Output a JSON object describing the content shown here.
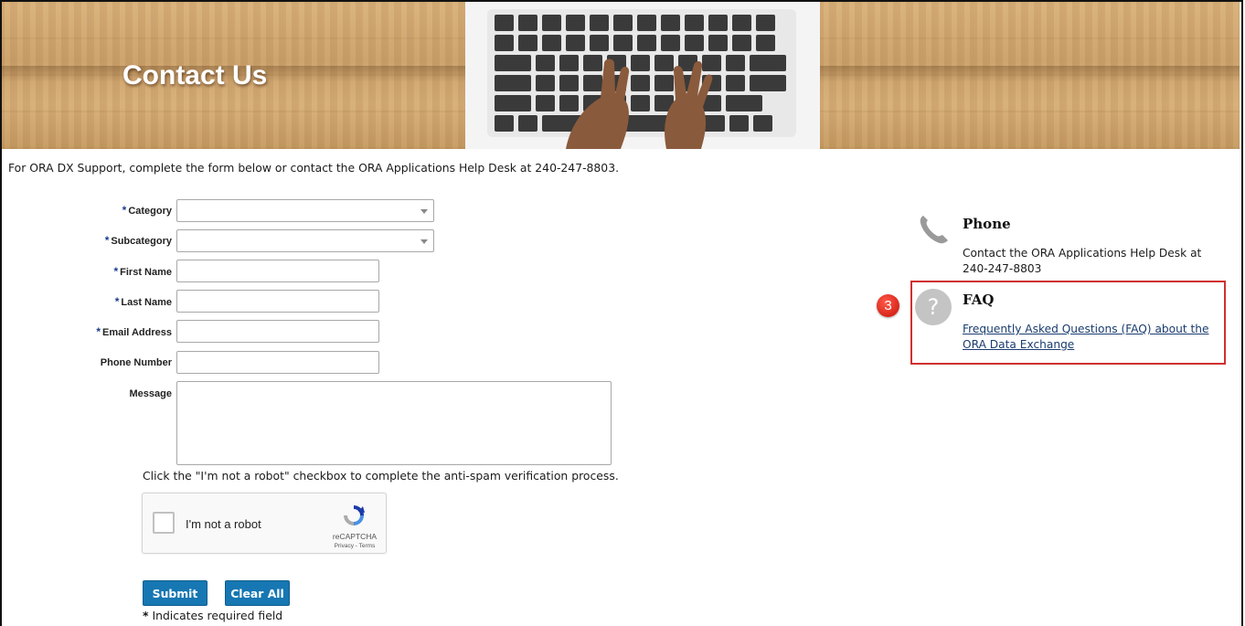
{
  "banner": {
    "title": "Contact Us"
  },
  "intro": "For ORA DX Support, complete the form below or contact the ORA Applications Help Desk at 240-247-8803.",
  "form": {
    "required_marker": "*",
    "category": {
      "label": "Category",
      "value": ""
    },
    "subcategory": {
      "label": "Subcategory",
      "value": ""
    },
    "first_name": {
      "label": "First Name",
      "value": ""
    },
    "last_name": {
      "label": "Last Name",
      "value": ""
    },
    "email": {
      "label": "Email Address",
      "value": ""
    },
    "phone": {
      "label": "Phone Number",
      "value": ""
    },
    "message": {
      "label": "Message",
      "value": ""
    },
    "captcha_note": "Click the \"I'm not a robot\" checkbox to complete the anti-spam verification process.",
    "captcha": {
      "label": "I'm not a robot",
      "brand": "reCAPTCHA",
      "terms": "Privacy - Terms",
      "checked": false
    },
    "submit_label": "Submit",
    "clear_label": "Clear All",
    "required_note_star": "*",
    "required_note": "Indicates required field"
  },
  "sidebar": {
    "phone": {
      "title": "Phone",
      "text": "Contact the ORA Applications Help Desk at 240-247-8803",
      "icon": "phone-icon"
    },
    "faq": {
      "title": "FAQ",
      "link": "Frequently Asked Questions (FAQ) about the ORA Data Exchange",
      "icon": "question-icon",
      "icon_glyph": "?"
    },
    "annotation_badge": "3"
  },
  "colors": {
    "button": "#1677b3",
    "link": "#1a3c70",
    "highlight": "#d03030",
    "required_star": "#1a3c8e"
  }
}
